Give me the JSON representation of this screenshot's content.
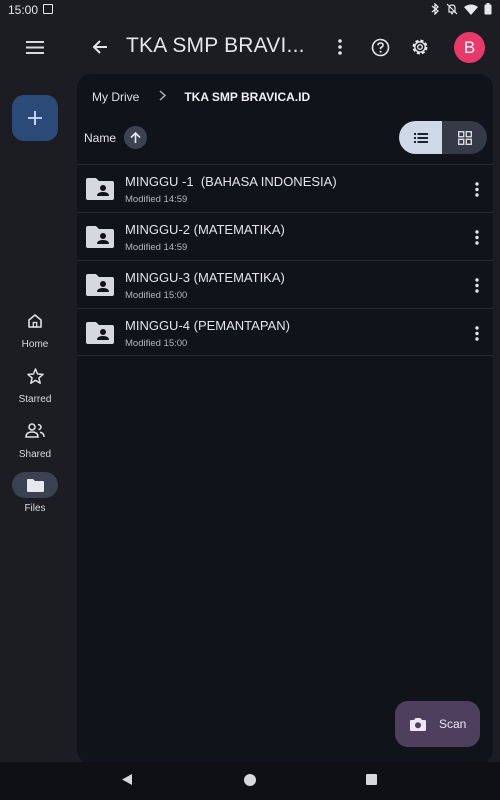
{
  "status_bar": {
    "time": "15:00",
    "icons": [
      "bluetooth-icon",
      "notifications-off-icon",
      "wifi-icon",
      "battery-icon"
    ]
  },
  "app_bar": {
    "title": "TKA SMP BRAVI...",
    "avatar_initial": "B",
    "avatar_color": "#e9396a"
  },
  "nav_rail": {
    "items": [
      {
        "label": "Home",
        "icon": "home-icon"
      },
      {
        "label": "Starred",
        "icon": "star-icon"
      },
      {
        "label": "Shared",
        "icon": "shared-icon"
      },
      {
        "label": "Files",
        "icon": "folder-icon",
        "active": true
      }
    ]
  },
  "breadcrumb": {
    "root": "My Drive",
    "current": "TKA SMP BRAVICA.ID"
  },
  "sort": {
    "label": "Name"
  },
  "files": [
    {
      "name": "MINGGU -1  (BAHASA INDONESIA)",
      "modified": "Modified 14:59"
    },
    {
      "name": "MINGGU-2 (MATEMATIKA)",
      "modified": "Modified 14:59"
    },
    {
      "name": "MINGGU-3 (MATEMATIKA)",
      "modified": "Modified 15:00"
    },
    {
      "name": "MINGGU-4 (PEMANTAPAN)",
      "modified": "Modified 15:00"
    }
  ],
  "scan_button": {
    "label": "Scan"
  },
  "colors": {
    "accent_fab": "#2c4a78",
    "scan_fab": "#4f3f5e",
    "panel": "#11131a"
  }
}
